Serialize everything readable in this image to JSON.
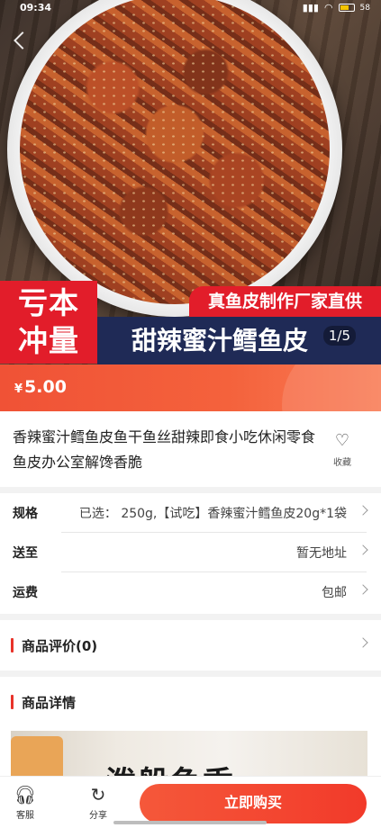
{
  "status_bar": {
    "time": "09:34",
    "battery": "58"
  },
  "hero": {
    "banner_left_line1": "亏本",
    "banner_left_line2": "冲量",
    "banner_top": "真鱼皮制作厂家直供",
    "banner_bottom": "甜辣蜜汁鳕鱼皮",
    "pager": "1/5"
  },
  "price": {
    "currency": "¥",
    "amount": "5.00"
  },
  "product": {
    "title": "香辣蜜汁鳕鱼皮鱼干鱼丝甜辣即食小吃休闲零食鱼皮办公室解馋香脆",
    "favorite_label": "收藏"
  },
  "specs": {
    "rows": [
      {
        "label": "规格",
        "value": "已选：  250g,【试吃】香辣蜜汁鳕鱼皮20g*1袋"
      },
      {
        "label": "送至",
        "value": "暂无地址"
      },
      {
        "label": "运费",
        "value": "包邮"
      }
    ]
  },
  "reviews": {
    "heading": "商品评价(0)"
  },
  "details": {
    "heading": "商品详情",
    "image_text": "泼般鱼香"
  },
  "bottom_bar": {
    "service_label": "客服",
    "share_label": "分享",
    "buy_label": "立即购买"
  },
  "icons": {
    "service": "headset-icon",
    "share": "share-icon",
    "favorite": "heart-plus-icon",
    "back": "back-arrow-icon"
  },
  "colors": {
    "accent": "#f23a2a",
    "banner_red": "#e21d2a",
    "banner_navy": "#1f2a56"
  }
}
